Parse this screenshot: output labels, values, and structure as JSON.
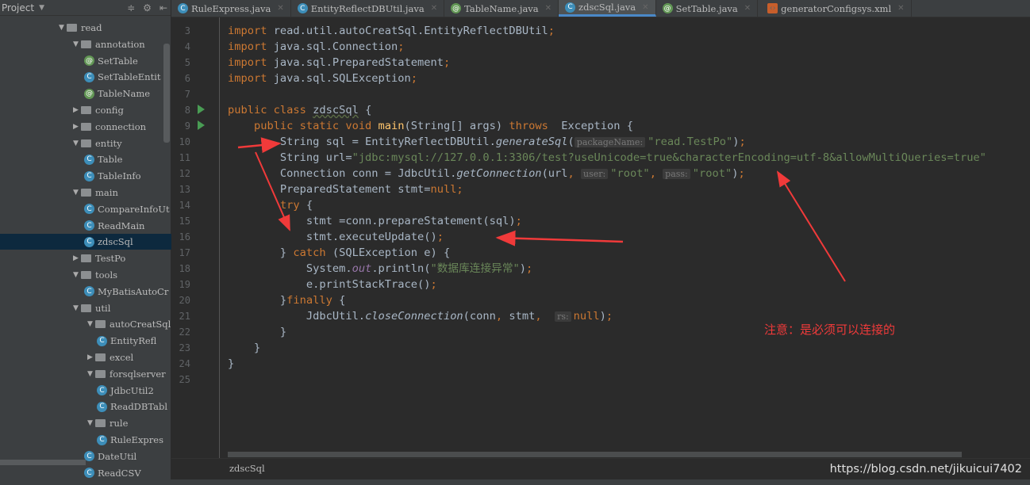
{
  "project_panel": {
    "title": "Project",
    "tree": [
      {
        "label": "read",
        "type": "folder",
        "level": 0,
        "expanded": true
      },
      {
        "label": "annotation",
        "type": "folder",
        "level": 1,
        "expanded": true
      },
      {
        "label": "SetTable",
        "type": "annotation",
        "level": 2
      },
      {
        "label": "SetTableEntit",
        "type": "class",
        "level": 2
      },
      {
        "label": "TableName",
        "type": "annotation",
        "level": 2
      },
      {
        "label": "config",
        "type": "folder",
        "level": 1,
        "expanded": false
      },
      {
        "label": "connection",
        "type": "folder",
        "level": 1,
        "expanded": false
      },
      {
        "label": "entity",
        "type": "folder",
        "level": 1,
        "expanded": true
      },
      {
        "label": "Table",
        "type": "class",
        "level": 2
      },
      {
        "label": "TableInfo",
        "type": "class",
        "level": 2
      },
      {
        "label": "main",
        "type": "folder",
        "level": 1,
        "expanded": true
      },
      {
        "label": "CompareInfoUt",
        "type": "class",
        "level": 2
      },
      {
        "label": "ReadMain",
        "type": "class",
        "level": 2
      },
      {
        "label": "zdscSql",
        "type": "class",
        "level": 2,
        "selected": true
      },
      {
        "label": "TestPo",
        "type": "folder",
        "level": 1,
        "expanded": false
      },
      {
        "label": "tools",
        "type": "folder",
        "level": 1,
        "expanded": true
      },
      {
        "label": "MyBatisAutoCr",
        "type": "class",
        "level": 2
      },
      {
        "label": "util",
        "type": "folder",
        "level": 1,
        "expanded": true
      },
      {
        "label": "autoCreatSql",
        "type": "folder",
        "level": 2,
        "expanded": true
      },
      {
        "label": "EntityRefl",
        "type": "class",
        "level": 3
      },
      {
        "label": "excel",
        "type": "folder",
        "level": 2,
        "expanded": false
      },
      {
        "label": "forsqlserver",
        "type": "folder",
        "level": 2,
        "expanded": true
      },
      {
        "label": "JdbcUtil2",
        "type": "class",
        "level": 3
      },
      {
        "label": "ReadDBTabl",
        "type": "class",
        "level": 3
      },
      {
        "label": "rule",
        "type": "folder",
        "level": 2,
        "expanded": true
      },
      {
        "label": "RuleExpres",
        "type": "class",
        "level": 3
      },
      {
        "label": "DateUtil",
        "type": "class",
        "level": 2
      },
      {
        "label": "ReadCSV",
        "type": "class",
        "level": 2
      }
    ]
  },
  "tabs": [
    {
      "label": "RuleExpress.java",
      "icon": "class"
    },
    {
      "label": "EntityReflectDBUtil.java",
      "icon": "class"
    },
    {
      "label": "TableName.java",
      "icon": "annotation"
    },
    {
      "label": "zdscSql.java",
      "icon": "class",
      "active": true
    },
    {
      "label": "SetTable.java",
      "icon": "annotation"
    },
    {
      "label": "generatorConfigsys.xml",
      "icon": "xml"
    }
  ],
  "code": [
    {
      "n": "3",
      "t": [
        [
          "kw",
          "import "
        ],
        [
          "",
          "read.util.autoCreatSql.EntityReflectDBUtil"
        ],
        [
          "kw",
          ";"
        ]
      ]
    },
    {
      "n": "4",
      "t": [
        [
          "kw",
          "import "
        ],
        [
          "",
          "java.sql.Connection"
        ],
        [
          "kw",
          ";"
        ]
      ]
    },
    {
      "n": "5",
      "t": [
        [
          "kw",
          "import "
        ],
        [
          "",
          "java.sql.PreparedStatement"
        ],
        [
          "kw",
          ";"
        ]
      ]
    },
    {
      "n": "6",
      "t": [
        [
          "kw",
          "import "
        ],
        [
          "",
          "java.sql.SQLException"
        ],
        [
          "kw",
          ";"
        ]
      ]
    },
    {
      "n": "7",
      "t": []
    },
    {
      "n": "8",
      "t": [
        [
          "kw",
          "public class "
        ],
        [
          "cls",
          "zdscSql"
        ],
        [
          "",
          " {"
        ]
      ]
    },
    {
      "n": "9",
      "t": [
        [
          "",
          "    "
        ],
        [
          "kw",
          "public static void "
        ],
        [
          "fn",
          "main"
        ],
        [
          "",
          "(String[] args) "
        ],
        [
          "kw",
          "throws "
        ],
        [
          "",
          " Exception {"
        ]
      ]
    },
    {
      "n": "10",
      "t": [
        [
          "",
          "        String sql = EntityReflectDBUtil."
        ],
        [
          "it",
          "generateSql"
        ],
        [
          "",
          "("
        ],
        [
          "hint",
          "packageName:"
        ],
        [
          "str",
          "\"read.TestPo\""
        ],
        [
          "",
          ")"
        ],
        [
          "kw",
          ";"
        ]
      ]
    },
    {
      "n": "11",
      "t": [
        [
          "",
          "        String url="
        ],
        [
          "str",
          "\"jdbc:mysql://127.0.0.1:3306/test?useUnicode=true&characterEncoding=utf-8&allowMultiQueries=true\""
        ]
      ]
    },
    {
      "n": "12",
      "t": [
        [
          "",
          "        Connection conn = JdbcUtil."
        ],
        [
          "it",
          "getConnection"
        ],
        [
          "",
          "(url"
        ],
        [
          "kw",
          ", "
        ],
        [
          "hint",
          "user:"
        ],
        [
          "str",
          "\"root\""
        ],
        [
          "kw",
          ", "
        ],
        [
          "hint",
          "pass:"
        ],
        [
          "str",
          "\"root\""
        ],
        [
          "",
          ")"
        ],
        [
          "kw",
          ";"
        ]
      ]
    },
    {
      "n": "13",
      "t": [
        [
          "",
          "        PreparedStatement stmt="
        ],
        [
          "kw",
          "null;"
        ]
      ]
    },
    {
      "n": "14",
      "t": [
        [
          "",
          "        "
        ],
        [
          "kw",
          "try "
        ],
        [
          "",
          "{"
        ]
      ]
    },
    {
      "n": "15",
      "t": [
        [
          "",
          "            stmt =conn.prepareStatement(sql)"
        ],
        [
          "kw",
          ";"
        ]
      ]
    },
    {
      "n": "16",
      "t": [
        [
          "",
          "            stmt.executeUpdate()"
        ],
        [
          "kw",
          ";"
        ]
      ]
    },
    {
      "n": "17",
      "t": [
        [
          "",
          "        } "
        ],
        [
          "kw",
          "catch "
        ],
        [
          "",
          "(SQLException e) {"
        ]
      ]
    },
    {
      "n": "18",
      "t": [
        [
          "",
          "            System."
        ],
        [
          "st",
          "out"
        ],
        [
          "",
          ".println("
        ],
        [
          "str",
          "\"数据库连接异常\""
        ],
        [
          "",
          ")"
        ],
        [
          "kw",
          ";"
        ]
      ]
    },
    {
      "n": "19",
      "t": [
        [
          "",
          "            e.printStackTrace()"
        ],
        [
          "kw",
          ";"
        ]
      ]
    },
    {
      "n": "20",
      "t": [
        [
          "",
          "        }"
        ],
        [
          "kw",
          "finally "
        ],
        [
          "",
          "{"
        ]
      ]
    },
    {
      "n": "21",
      "t": [
        [
          "",
          "            JdbcUtil."
        ],
        [
          "it",
          "closeConnection"
        ],
        [
          "",
          "(conn"
        ],
        [
          "kw",
          ", "
        ],
        [
          "",
          "stmt"
        ],
        [
          "kw",
          ",  "
        ],
        [
          "hint",
          "rs:"
        ],
        [
          "kw",
          "null"
        ],
        [
          "",
          ")"
        ],
        [
          "kw",
          ";"
        ]
      ]
    },
    {
      "n": "22",
      "t": [
        [
          "",
          "        }"
        ]
      ]
    },
    {
      "n": "23",
      "t": [
        [
          "",
          "    }"
        ]
      ]
    },
    {
      "n": "24",
      "t": [
        [
          "",
          "}"
        ]
      ]
    },
    {
      "n": "25",
      "t": []
    }
  ],
  "breadcrumb": "zdscSql",
  "annotation_note": "注意：是必须可以连接的",
  "watermark": "https://blog.csdn.net/jikuicui7402",
  "colors": {
    "annotation_red": "#f03a3a",
    "keyword": "#cc7832",
    "string": "#6a8759"
  }
}
